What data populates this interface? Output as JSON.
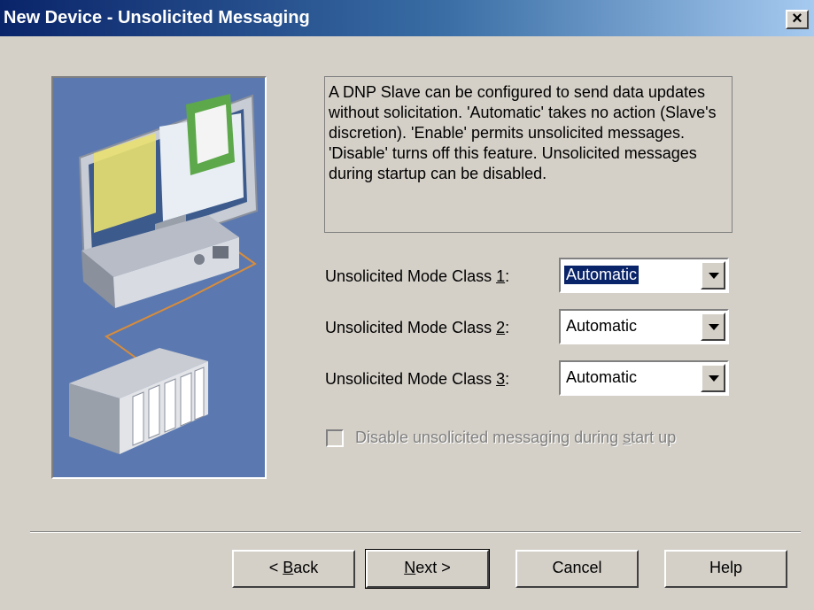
{
  "window": {
    "title": "New Device - Unsolicited Messaging",
    "close_label": "×"
  },
  "description": "A DNP Slave can be configured to send data updates without solicitation. 'Automatic' takes no action (Slave's discretion).  'Enable' permits unsolicited messages. 'Disable' turns off this feature. Unsolicited messages during startup can be disabled.",
  "fields": [
    {
      "label_pre": "Unsolicited Mode Class ",
      "label_key": "1",
      "label_post": ":",
      "value": "Automatic",
      "focused": true
    },
    {
      "label_pre": "Unsolicited Mode Class ",
      "label_key": "2",
      "label_post": ":",
      "value": "Automatic",
      "focused": false
    },
    {
      "label_pre": "Unsolicited Mode Class ",
      "label_key": "3",
      "label_post": ":",
      "value": "Automatic",
      "focused": false
    }
  ],
  "checkbox": {
    "label_pre": "Disable unsolicited messaging during ",
    "label_key": "s",
    "label_post": "tart up",
    "checked": false,
    "enabled": false
  },
  "buttons": {
    "back": {
      "pre": "< ",
      "key": "B",
      "post": "ack"
    },
    "next": {
      "pre": "",
      "key": "N",
      "post": "ext >"
    },
    "cancel": "Cancel",
    "help": "Help"
  },
  "colors": {
    "dialog_bg": "#d4d0c8",
    "titlebar_start": "#0a246a",
    "titlebar_end": "#a6caf0",
    "image_bg": "#5b79b0",
    "selection": "#0a246a"
  }
}
